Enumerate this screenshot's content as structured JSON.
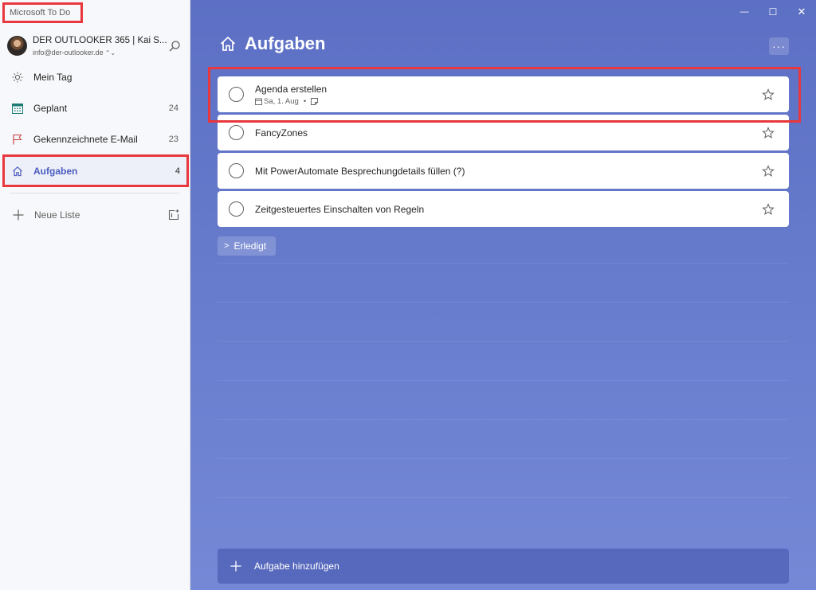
{
  "app": {
    "title": "Microsoft To Do"
  },
  "account": {
    "name": "DER OUTLOOKER 365 | Kai S...",
    "email": "info@der-outlooker.de",
    "email_chevron": "⌃⌄"
  },
  "sidebar": {
    "items": [
      {
        "label": "Mein Tag",
        "count": "",
        "icon": "sun-icon"
      },
      {
        "label": "Geplant",
        "count": "24",
        "icon": "calendar-icon"
      },
      {
        "label": "Gekennzeichnete E-Mail",
        "count": "23",
        "icon": "flag-icon"
      },
      {
        "label": "Aufgaben",
        "count": "4",
        "icon": "home-icon"
      }
    ],
    "new_list_label": "Neue Liste"
  },
  "window_controls": {
    "minimize": "—",
    "maximize": "☐",
    "close": "✕"
  },
  "main": {
    "title": "Aufgaben",
    "more_label": "···",
    "tasks": [
      {
        "title": "Agenda erstellen",
        "due": "Sa, 1. Aug",
        "meta_sep": "•"
      },
      {
        "title": "FancyZones"
      },
      {
        "title": "Mit PowerAutomate Besprechungdetails füllen (?)"
      },
      {
        "title": "Zeitgesteuertes Einschalten von Regeln"
      }
    ],
    "completed_label": "Erledigt",
    "completed_chevron": ">",
    "add_task_label": "Aufgabe hinzufügen"
  },
  "colors": {
    "accent": "#4a5bbf",
    "highlight": "#e8373d",
    "background_start": "#5c6fc4",
    "background_end": "#7488d6"
  }
}
